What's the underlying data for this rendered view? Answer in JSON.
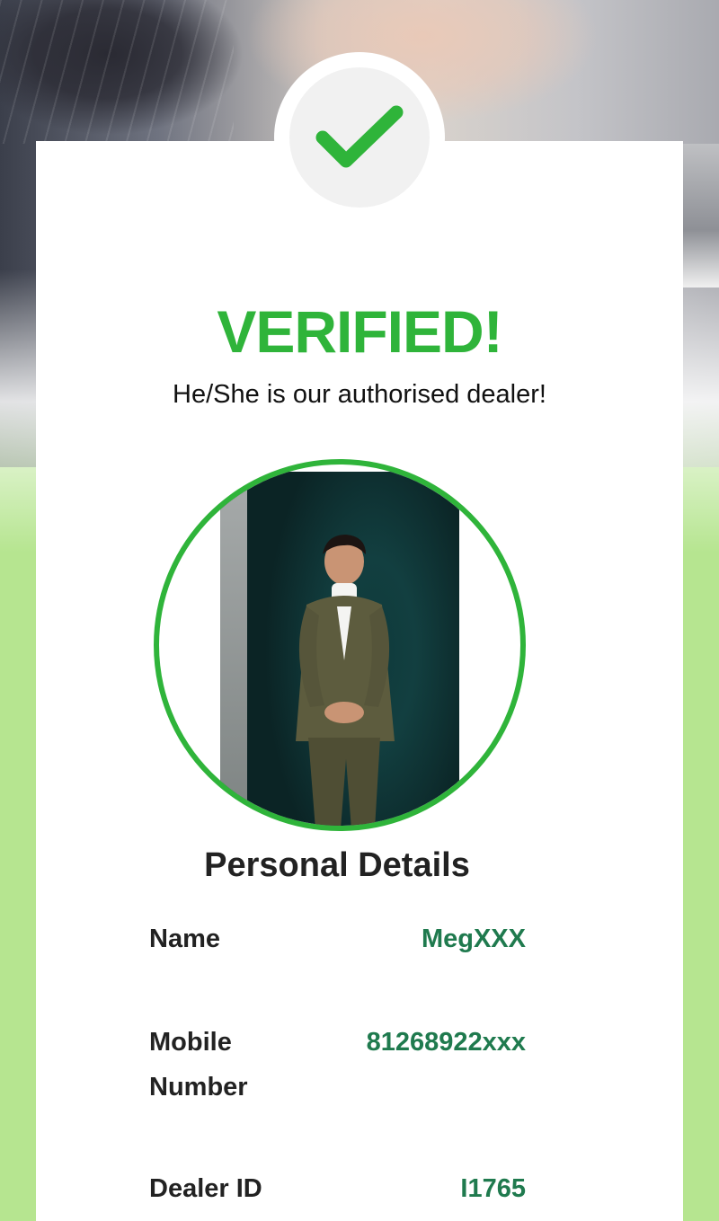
{
  "header": {
    "title": "VERIFIED!",
    "subtitle": "He/She is our authorised dealer!",
    "status_icon": "checkmark-icon"
  },
  "profile": {
    "photo": "dealer-photo"
  },
  "details": {
    "section_title": "Personal Details",
    "rows": [
      {
        "label": "Name",
        "value": "MegXXX"
      },
      {
        "label": "Mobile Number",
        "value": "81268922xxx"
      },
      {
        "label": "Dealer ID",
        "value": "I1765"
      }
    ]
  },
  "colors": {
    "accent_green": "#2fb43a",
    "value_green": "#1f7a4e",
    "background_green": "#b6e590"
  }
}
